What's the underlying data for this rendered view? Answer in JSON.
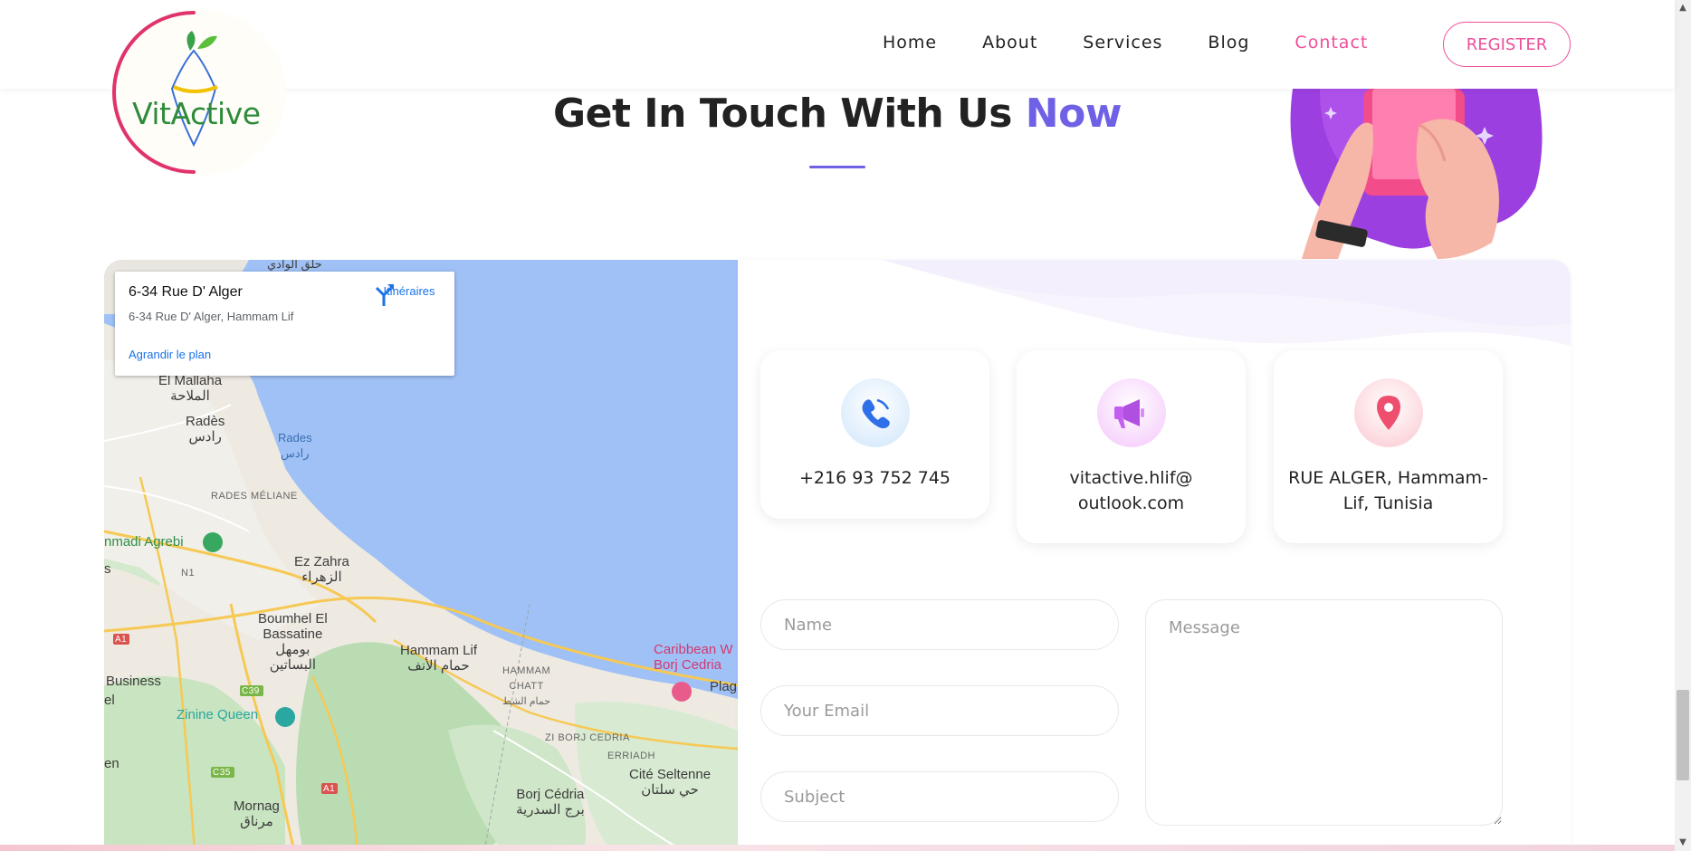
{
  "brand": {
    "logo_text": "VitActive"
  },
  "nav": {
    "items": [
      {
        "label": "Home"
      },
      {
        "label": "About"
      },
      {
        "label": "Services"
      },
      {
        "label": "Blog"
      },
      {
        "label": "Contact"
      }
    ],
    "active": "Contact",
    "register_label": "REGISTER"
  },
  "hero": {
    "title_main": "Get In Touch With Us ",
    "title_accent": "Now"
  },
  "map": {
    "card": {
      "title": "6-34 Rue D' Alger",
      "address": "6-34 Rue D' Alger, Hammam Lif",
      "directions_label": "Itinéraires",
      "enlarge_label": "Agrandir le plan"
    },
    "labels": {
      "el_mallaha": "El Mallaha",
      "el_mallaha_ar": "الملاحة",
      "rades": "Radès",
      "rades_ar": "رادس",
      "rades_water": "Rades",
      "rades_water_ar": "رادس",
      "rades_meliane": "RADES MÉLIANE",
      "hammadi_agrebi": "nmadi Agrebi",
      "ez_zahra": "Ez Zahra",
      "ez_zahra_ar": "الزهراء",
      "boumhel": "Boumhel El",
      "bassatine": "Bassatine",
      "boumhel_ar": "بومهل",
      "bassatine_ar": "البساتين",
      "hammam_lif": "Hammam Lif",
      "hammam_lif_ar": "حمام الأنف",
      "hammam_chatt": "HAMMAM",
      "hammam_chatt2": "CHATT",
      "hammam_chatt_ar": "حمام الشط",
      "caribbean": "Caribbean W",
      "borj_cedria_poi": "Borj Cedria",
      "plag": "Plag",
      "business": "Business",
      "zinine_queen": "Zinine Queen",
      "zi_borj_cedria": "ZI BORJ CEDRIA",
      "erriadh": "ERRIADH",
      "cite_seltenne": "Cité Seltenne",
      "cite_seltenne_ar": "حي سلتان",
      "borj_cedria": "Borj Cédria",
      "borj_cedria_ar": "برج السدرية",
      "mornag": "Mornag",
      "mornag_ar": "مرناق",
      "left_s": "s",
      "left_en": "en",
      "left_el": "el",
      "road_n1": "N1",
      "road_a1": "A1",
      "road_a1b": "A1",
      "road_c39": "C39",
      "road_c35": "C35",
      "top_ar": "حلق الوادي"
    }
  },
  "contact": {
    "cards": [
      {
        "icon": "phone-icon",
        "text": "+216 93 752 745",
        "color": "#2f6fe8"
      },
      {
        "icon": "megaphone-icon",
        "text": "vitactive.hlif@ outlook.com",
        "color": "#b14fe0"
      },
      {
        "icon": "location-pin-icon",
        "text": "RUE ALGER, Hammam-Lif, Tunisia",
        "color": "#ef4f6e"
      }
    ],
    "form": {
      "name_placeholder": "Name",
      "email_placeholder": "Your Email",
      "subject_placeholder": "Subject",
      "message_placeholder": "Message"
    }
  },
  "colors": {
    "accent_purple": "#6f61e6",
    "accent_pink": "#ee4f9a",
    "map_water": "#9fc1f6"
  }
}
